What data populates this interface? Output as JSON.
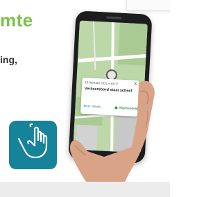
{
  "banner": {
    "heading_fragment": "mte",
    "subtext_fragment": "ing,"
  },
  "app_icon": {
    "name": "tap-hand-icon",
    "background": "#17839a"
  },
  "phone_app": {
    "popup": {
      "date": "10 februari 2021 • 10:07",
      "close_symbol": "×",
      "title": "Verkeersbord staat scheef",
      "link": "Meer details...",
      "status": "Afgehandeld",
      "status_color": "#3b9a4a"
    }
  },
  "colors": {
    "heading_green": "#7cc24a",
    "map_green": "#bcd7a8",
    "link_blue": "#3a78c2"
  }
}
